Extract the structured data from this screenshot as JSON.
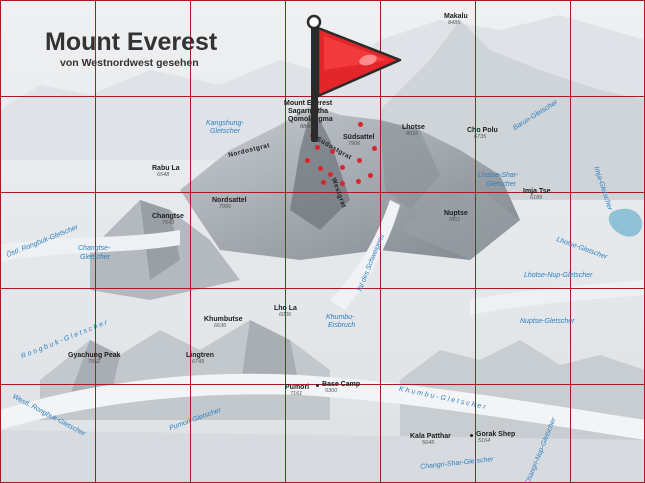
{
  "title": "Mount Everest",
  "subtitle": "von Westnordwest gesehen",
  "colors": {
    "grid": "#a51d24",
    "flag": "#e32629",
    "flag_highlight": "#ff8b8b",
    "pole": "#2b2b2b",
    "glacier_text": "#2e7fbf",
    "route_dots": "#d7262c"
  },
  "grid": {
    "columns": 7,
    "rows": 5
  },
  "flag_icon": "flag-icon",
  "peaks": {
    "makalu": {
      "name": "Makalu",
      "elev": "8485"
    },
    "everest": {
      "line1": "Mount Everest",
      "line2": "Sagarmatha",
      "line3": "Qomolangma",
      "elev": "8848"
    },
    "lhotse": {
      "name": "Lhotse",
      "elev": "8516"
    },
    "cho_polu": {
      "name": "Cho Polu",
      "elev": "6735"
    },
    "rabu_la": {
      "name": "Rabu La",
      "elev": "6548"
    },
    "nordsattel": {
      "name": "Nordsattel",
      "elev": "7066"
    },
    "changtse": {
      "name": "Changtse",
      "elev": "7543"
    },
    "nuptse": {
      "name": "Nuptse",
      "elev": "7861"
    },
    "imja_tse": {
      "name": "Imja Tse",
      "elev": "6189"
    },
    "lho_la": {
      "name": "Lho La",
      "elev": "6006"
    },
    "khumbutse": {
      "name": "Khumbutse",
      "elev": "6636"
    },
    "gyachung": {
      "name": "Gyachung Peak",
      "elev": "7952"
    },
    "lingtren": {
      "name": "Lingtren",
      "elev": "6749"
    },
    "pumori": {
      "name": "Pumori",
      "elev": "7161"
    },
    "base_camp": {
      "name": "Base Camp",
      "elev": "5300"
    },
    "kala_patthar": {
      "name": "Kala Patthar",
      "elev": "5645"
    },
    "gorak_shep": {
      "name": "Gorak Shep",
      "elev": "5164"
    },
    "suedsattel": {
      "name": "Südsattel",
      "elev": "7906"
    }
  },
  "ridges": {
    "nordostgrat": "Nordostgrat",
    "suedostgrat": "Südostgrat",
    "westgrat": "Westgrat"
  },
  "glaciers": {
    "kangshung": {
      "line1": "Kangshung-",
      "line2": "Gletscher"
    },
    "barun": "Barun-Gletscher",
    "lhotse_shar": {
      "line1": "Lhotse-Shar-",
      "line2": "Gletscher"
    },
    "imja": "Imja-Gletscher",
    "ostl_rongbuk": "Östl. Rongbuk-Gletscher",
    "changtse_gl": {
      "line1": "Changtse-",
      "line2": "Gletscher"
    },
    "lhotse_gl": "Lhotse-Gletscher",
    "tal_schweigens": "Tal des Schweigens",
    "lhotse_nup": "Lhotse-Nup-Gletscher",
    "nuptse_gl": "Nuptse-Gletscher",
    "khumbu_eisbruch": {
      "line1": "Khumbu-",
      "line2": "Eisbruch"
    },
    "rongbuk": "Rongbuk-Gletscher",
    "westl_rongbuk": "Westl. Rongbuk-Gletscher",
    "pumori_gl": "Pumori-Gletscher",
    "khumbu_gl": "Khumbu-Gletscher",
    "changri_shar": "Changri-Shar-Gletscher",
    "changri_nup": "Changri-Nup-Gletscher"
  }
}
